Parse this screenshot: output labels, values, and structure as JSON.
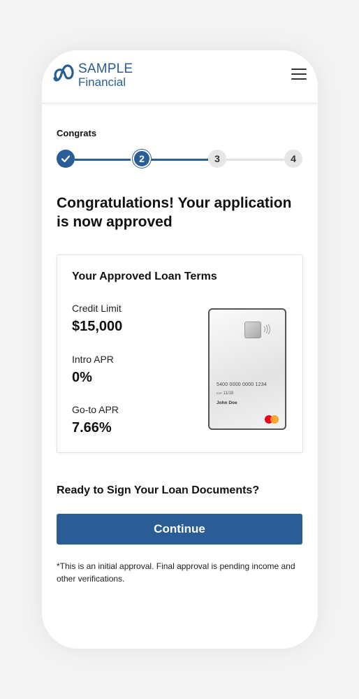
{
  "brand": {
    "line1": "SAMPLE",
    "line2": "Financial",
    "color": "#2a5d96"
  },
  "stepper": {
    "label": "Congrats",
    "steps": [
      {
        "number": "",
        "state": "done",
        "icon": "checkmark-icon"
      },
      {
        "number": "2",
        "state": "current"
      },
      {
        "number": "3",
        "state": "todo"
      },
      {
        "number": "4",
        "state": "todo"
      }
    ]
  },
  "main": {
    "title": "Congratulations! Your application is now approved"
  },
  "loan_terms": {
    "title": "Your Approved Loan Terms",
    "items": [
      {
        "label": "Credit Limit",
        "value": "$15,000"
      },
      {
        "label": "Intro APR",
        "value": "0%"
      },
      {
        "label": "Go-to APR",
        "value": "7.66%"
      }
    ],
    "card": {
      "number": "5400 0000 0000 1234",
      "exp_prefix": "EXP",
      "exp": "11/18",
      "name": "John Doe"
    }
  },
  "cta": {
    "question": "Ready to Sign Your Loan Documents?",
    "button_label": "Continue"
  },
  "disclaimer": "*This is an initial approval. Final approval is pending income and other verifications."
}
